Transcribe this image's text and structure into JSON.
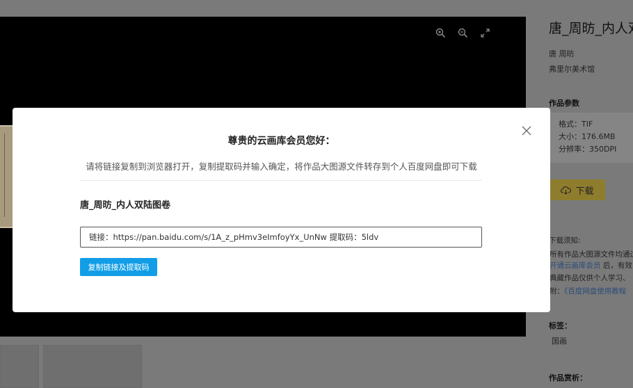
{
  "viewer": {
    "tools": [
      {
        "icon": "zoom-in-icon"
      },
      {
        "icon": "zoom-out-icon"
      },
      {
        "icon": "fullscreen-icon"
      }
    ]
  },
  "sidebar": {
    "title": "唐_周昉_内人双",
    "author": "唐   周昉",
    "museum": "弗里尔美术馆",
    "params_heading": "作品参数",
    "format": "格式：TIF",
    "size": "大小：176.6MB",
    "resolution": "分辨率：350DPI",
    "download_label": "下载",
    "notice_heading": "下载须知:",
    "notice_line1": "所有作品大图源文件均通过",
    "notice_link": "开通云画库会员",
    "notice_line2_rest": " 后，有效",
    "notice_line3": "典藏作品仅供个人学习、",
    "notice_line4_prefix": "附：",
    "notice_line4_link": "《百度网盘使用教程",
    "tags_heading": "标签：",
    "tag": "国画",
    "appreciation_heading": "作品赏析："
  },
  "modal": {
    "title": "尊贵的云画库会员您好：",
    "description": "请将链接复制到浏览器打开，复制提取码并输入确定，将作品大图源文件转存到个人百度网盘即可下载",
    "work_title": "唐_周昉_内人双陆图卷",
    "link_text": "链接：https://pan.baidu.com/s/1A_z_pHmv3eImfoyYx_UnNw 提取码：5ldv",
    "copy_button": "复制链接及提取码"
  },
  "colors": {
    "accent": "#129ee7",
    "backdrop": "#7a7a7a",
    "download_button": "#8f7d2e"
  }
}
